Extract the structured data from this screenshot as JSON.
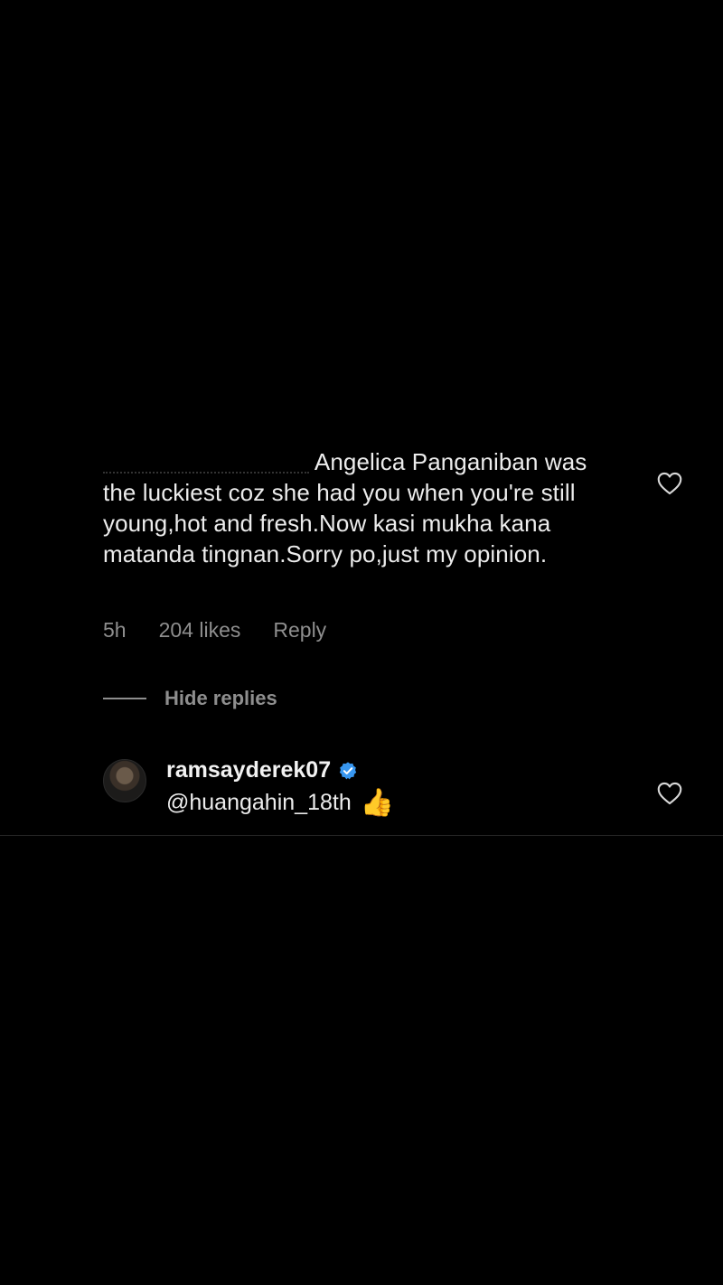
{
  "comment": {
    "text": "Angelica Panganiban was the luckiest coz she had you when you're still young,hot and fresh.Now kasi mukha kana matanda tingnan.Sorry po,just my opinion.",
    "time": "5h",
    "likes": "204 likes",
    "reply_label": "Reply",
    "heart_icon": "heart-outline-icon"
  },
  "replies_toggle": {
    "label": "Hide replies"
  },
  "reply": {
    "username": "ramsayderek07",
    "verified_icon": "verified-badge-icon",
    "mention": "@huangahin_18th",
    "emoji": "👍",
    "heart_icon": "heart-outline-icon"
  },
  "colors": {
    "background": "#000000",
    "text": "#ececec",
    "muted": "#8e8e8e",
    "verified": "#3897f0"
  }
}
